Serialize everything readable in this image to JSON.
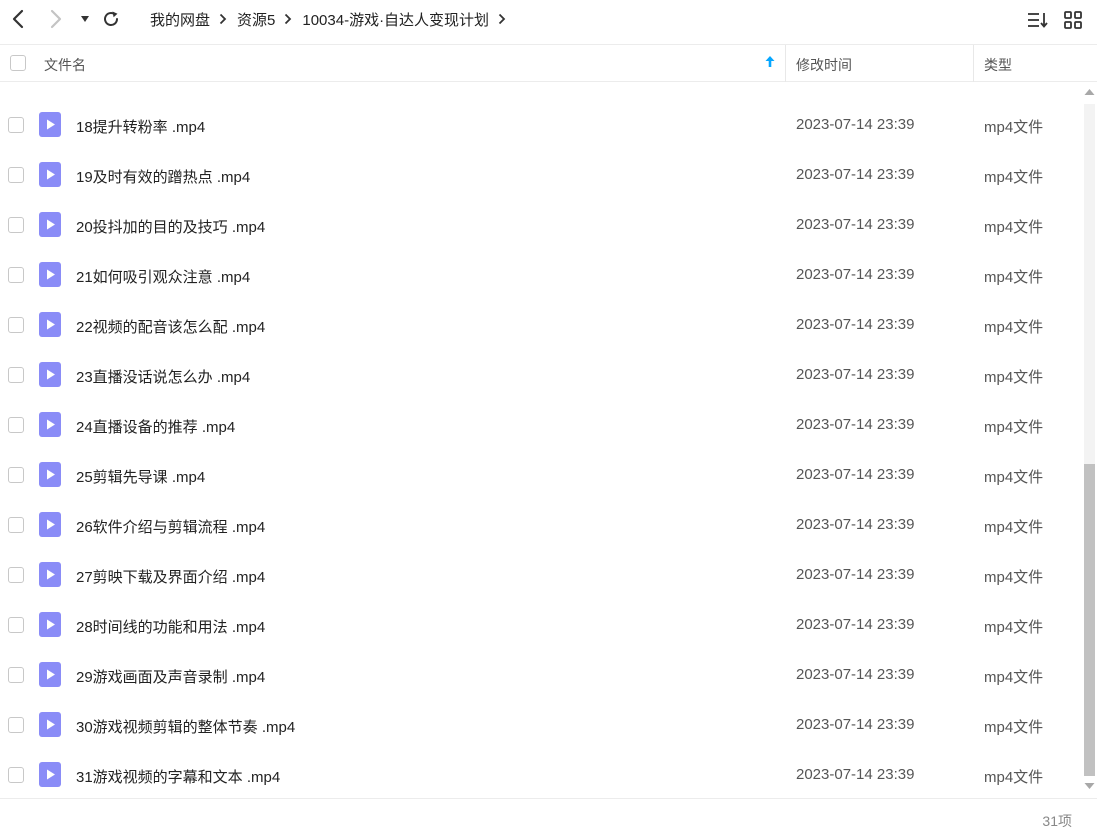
{
  "toolbar": {
    "breadcrumb": [
      "我的网盘",
      "资源5",
      "10034-游戏·自达人变现计划"
    ]
  },
  "header": {
    "name_label": "文件名",
    "time_label": "修改时间",
    "type_label": "类型"
  },
  "files": [
    {
      "name": "18提升转粉率 .mp4",
      "time": "2023-07-14 23:39",
      "type": "mp4文件"
    },
    {
      "name": "19及时有效的蹭热点 .mp4",
      "time": "2023-07-14 23:39",
      "type": "mp4文件"
    },
    {
      "name": "20投抖加的目的及技巧 .mp4",
      "time": "2023-07-14 23:39",
      "type": "mp4文件"
    },
    {
      "name": "21如何吸引观众注意 .mp4",
      "time": "2023-07-14 23:39",
      "type": "mp4文件"
    },
    {
      "name": "22视频的配音该怎么配 .mp4",
      "time": "2023-07-14 23:39",
      "type": "mp4文件"
    },
    {
      "name": "23直播没话说怎么办 .mp4",
      "time": "2023-07-14 23:39",
      "type": "mp4文件"
    },
    {
      "name": "24直播设备的推荐 .mp4",
      "time": "2023-07-14 23:39",
      "type": "mp4文件"
    },
    {
      "name": "25剪辑先导课 .mp4",
      "time": "2023-07-14 23:39",
      "type": "mp4文件"
    },
    {
      "name": "26软件介绍与剪辑流程 .mp4",
      "time": "2023-07-14 23:39",
      "type": "mp4文件"
    },
    {
      "name": "27剪映下载及界面介绍 .mp4",
      "time": "2023-07-14 23:39",
      "type": "mp4文件"
    },
    {
      "name": "28时间线的功能和用法 .mp4",
      "time": "2023-07-14 23:39",
      "type": "mp4文件"
    },
    {
      "name": "29游戏画面及声音录制 .mp4",
      "time": "2023-07-14 23:39",
      "type": "mp4文件"
    },
    {
      "name": "30游戏视频剪辑的整体节奏 .mp4",
      "time": "2023-07-14 23:39",
      "type": "mp4文件"
    },
    {
      "name": "31游戏视频的字幕和文本 .mp4",
      "time": "2023-07-14 23:39",
      "type": "mp4文件"
    }
  ],
  "footer": {
    "count": "31项"
  },
  "colors": {
    "accent": "#06a7ff",
    "file_icon": "#8a8cf7"
  },
  "icons": {
    "back": "chevron-left-icon",
    "forward": "chevron-right-icon",
    "history": "caret-down-icon",
    "refresh": "refresh-icon",
    "sort": "sort-list-icon",
    "view": "grid-view-icon",
    "file": "video-file-icon"
  }
}
